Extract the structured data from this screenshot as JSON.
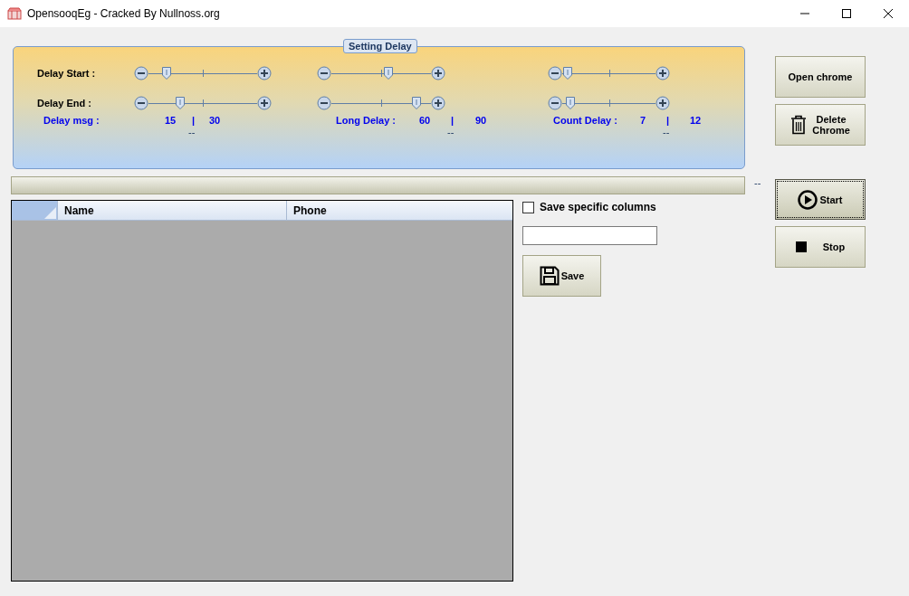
{
  "window": {
    "title": "OpensooqEg - Cracked By Nullnoss.org"
  },
  "settings_group": {
    "title": "Setting Delay",
    "rows": [
      {
        "label": "Delay Start :",
        "sliders": [
          {
            "level": 0.17
          },
          {
            "level": 0.57
          },
          {
            "level": 0.06
          }
        ]
      },
      {
        "label": "Delay End :",
        "sliders": [
          {
            "level": 0.29
          },
          {
            "level": 0.85
          },
          {
            "level": 0.09
          }
        ]
      }
    ],
    "summaries": [
      {
        "label": "Delay msg :",
        "start": "15",
        "separator": "|",
        "end": "30",
        "dash": "--"
      },
      {
        "label": "Long Delay :",
        "start": "60",
        "separator": "|",
        "end": "90",
        "dash": "--"
      },
      {
        "label": "Count Delay  :",
        "start": "7",
        "separator": "|",
        "end": "12",
        "dash": "--"
      }
    ]
  },
  "progress": {
    "level": 0,
    "status": "--"
  },
  "table": {
    "columns": [
      "Name",
      "Phone"
    ]
  },
  "save_panel": {
    "checkbox": {
      "label": "Save specific columns",
      "checked": false
    },
    "button": "Save"
  },
  "buttons": [
    {
      "label": "Open chrome",
      "kind": "plain",
      "focused": false
    },
    {
      "label": "Delete Chrome",
      "kind": "trash",
      "focused": false
    },
    {
      "label": "Start",
      "kind": "play",
      "focused": true
    },
    {
      "label": "Stop",
      "kind": "stop",
      "focused": false
    }
  ]
}
